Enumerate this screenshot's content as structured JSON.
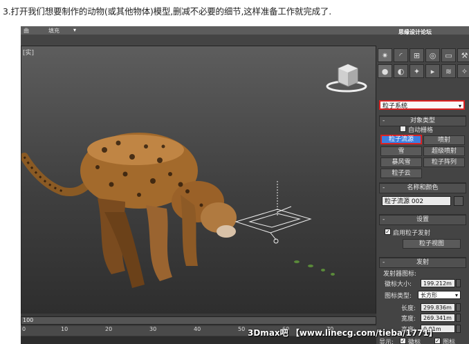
{
  "caption": "3.打开我们想要制作的动物(或其他物体)模型,删减不必要的细节,这样准备工作就完成了.",
  "topbar": {
    "item1": "曲",
    "item2": "填充"
  },
  "site_logo": "思缘设计论坛",
  "viewport": {
    "label": "[实]"
  },
  "command_panel": {
    "tabs": [
      "create-icon",
      "modify-icon",
      "hierarchy-icon",
      "motion-icon",
      "display-icon",
      "utilities-icon"
    ],
    "category_dropdown": "粒子系统",
    "object_type": {
      "title": "对象类型",
      "autogrid_label": "自动栅格",
      "buttons": [
        {
          "label": "粒子流源",
          "selected": true
        },
        {
          "label": "喷射",
          "selected": false
        },
        {
          "label": "雪",
          "selected": false
        },
        {
          "label": "超级喷射",
          "selected": false
        },
        {
          "label": "暴风雪",
          "selected": false
        },
        {
          "label": "粒子阵列",
          "selected": false
        },
        {
          "label": "粒子云",
          "selected": false
        }
      ]
    },
    "name_color": {
      "title": "名称和颜色",
      "name_value": "粒子流源 002",
      "swatch": "#5a5a5a"
    },
    "setup": {
      "title": "设置",
      "enable_label": "启用粒子发射",
      "enable_checked": true,
      "particle_view_btn": "粒子视图"
    },
    "emission": {
      "title": "发射",
      "icon_group": "发射器图标:",
      "logo_size_label": "徽标大小:",
      "logo_size_value": "199.212m",
      "icon_type_label": "图标类型:",
      "icon_type_value": "长方形",
      "length_label": "长度:",
      "length_value": "299.836m",
      "width_label": "宽度:",
      "width_value": "269.341m",
      "height_label": "高度:",
      "height_value": "0.01m",
      "display_label": "显示:",
      "show_logo_label": "徽标",
      "show_icon_label": "图标",
      "show_logo_checked": true,
      "show_icon_checked": true
    }
  },
  "timeline": {
    "frame": "100",
    "ticks": [
      "0",
      "10",
      "20",
      "30",
      "40",
      "50",
      "60",
      "70"
    ]
  },
  "watermark": "3Dmax吧 【www.linecg.com/tieba/1771】",
  "colors": {
    "accent_red": "#dd2222",
    "selected_blue": "#3d7fe0"
  }
}
